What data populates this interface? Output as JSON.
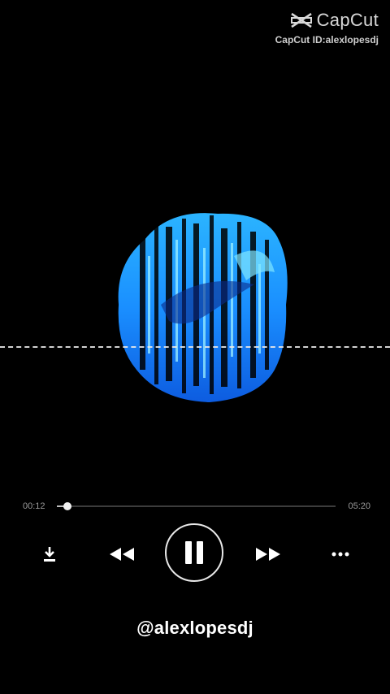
{
  "watermark": {
    "brand": "CapCut",
    "id_text": "CapCut ID:alexlopesdj",
    "icon": "capcut-logo-icon"
  },
  "artwork": {
    "icon": "album-art-logo",
    "colors": {
      "primary": "#1aa8ff",
      "highlight": "#7fe6ff",
      "dark": "#0a2a8a"
    }
  },
  "player": {
    "current_time": "00:12",
    "total_time": "05:20",
    "progress": 0.037
  },
  "controls": {
    "download": "download-icon",
    "previous": "rewind-icon",
    "play_pause": "pause-icon",
    "next": "fast-forward-icon",
    "more": "more-icon"
  },
  "footer": {
    "handle": "@alexlopesdj"
  }
}
